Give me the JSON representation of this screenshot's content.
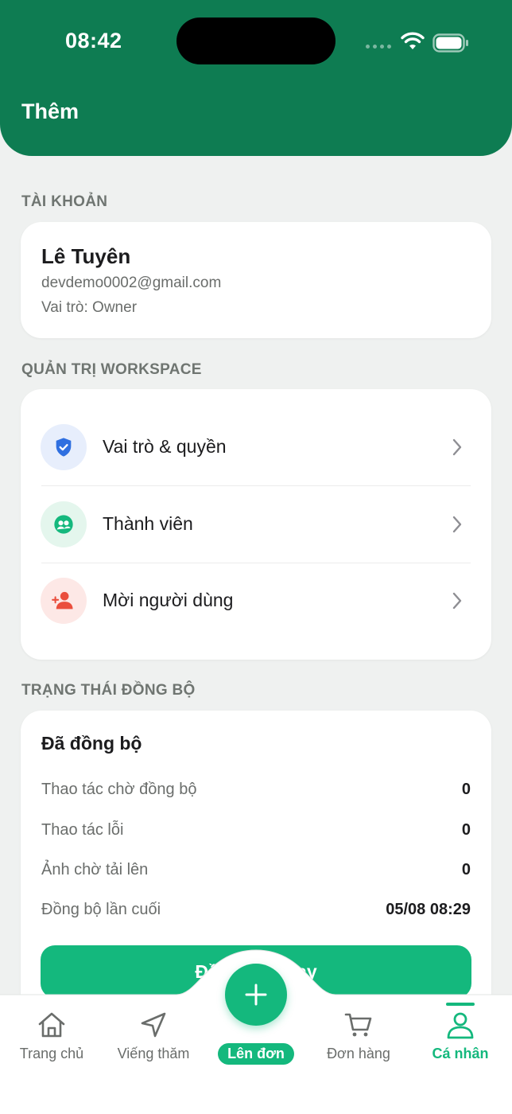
{
  "status_bar": {
    "time": "08:42"
  },
  "header": {
    "title": "Thêm"
  },
  "account": {
    "section_label": "TÀI KHOẢN",
    "name": "Lê Tuyên",
    "email": "devdemo0002@gmail.com",
    "role": "Vai trò: Owner"
  },
  "workspace": {
    "section_label": "QUẢN TRỊ WORKSPACE",
    "items": [
      {
        "label": "Vai trò & quyền",
        "icon": "shield-check-icon"
      },
      {
        "label": "Thành viên",
        "icon": "members-icon"
      },
      {
        "label": "Mời người dùng",
        "icon": "invite-user-icon"
      }
    ]
  },
  "sync": {
    "section_label": "TRẠNG THÁI ĐỒNG BỘ",
    "title": "Đã đồng bộ",
    "rows": [
      {
        "key": "Thao tác chờ đồng bộ",
        "value": "0"
      },
      {
        "key": "Thao tác lỗi",
        "value": "0"
      },
      {
        "key": "Ảnh chờ tải lên",
        "value": "0"
      },
      {
        "key": "Đồng bộ lần cuối",
        "value": "05/08 08:29"
      }
    ],
    "button_label": "Đồng bộ ngay"
  },
  "tabs": [
    {
      "label": "Trang chủ",
      "icon": "home-icon"
    },
    {
      "label": "Viếng thăm",
      "icon": "navigation-icon"
    },
    {
      "label": "Lên đơn",
      "icon": "plus-icon"
    },
    {
      "label": "Đơn hàng",
      "icon": "cart-icon"
    },
    {
      "label": "Cá nhân",
      "icon": "user-icon"
    }
  ],
  "colors": {
    "header": "#0e7c52",
    "accent": "#14b87d",
    "background": "#eff1f0"
  }
}
